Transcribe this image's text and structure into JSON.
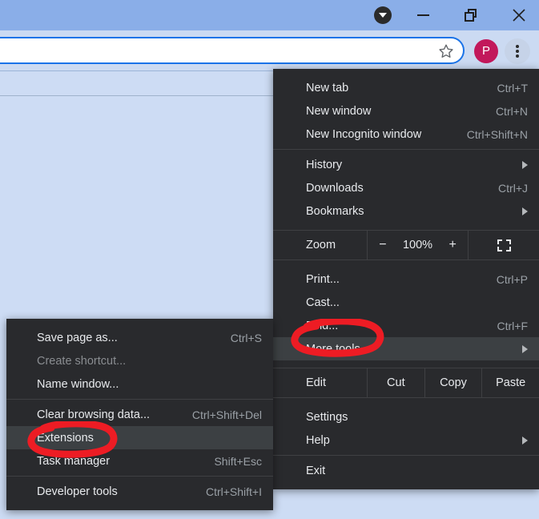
{
  "window": {
    "controls": [
      {
        "name": "update-available",
        "icon": "chevron-down-circle-icon"
      },
      {
        "name": "minimize",
        "icon": "minimize-icon"
      },
      {
        "name": "restore",
        "icon": "restore-window-icon"
      },
      {
        "name": "close",
        "icon": "close-icon",
        "glyph": "✕"
      }
    ]
  },
  "toolbar": {
    "address_value": "",
    "address_placeholder": "",
    "bookmark_icon": "star-icon",
    "profile_initial": "P",
    "menu_icon": "three-dots-vertical-icon"
  },
  "main_menu": {
    "items": [
      {
        "label": "New tab",
        "accel": "Ctrl+T",
        "submenu": false,
        "highlight": false,
        "disabled": false
      },
      {
        "label": "New window",
        "accel": "Ctrl+N",
        "submenu": false,
        "highlight": false,
        "disabled": false
      },
      {
        "label": "New Incognito window",
        "accel": "Ctrl+Shift+N",
        "submenu": false,
        "highlight": false,
        "disabled": false
      },
      {
        "label": "History",
        "accel": "",
        "submenu": true,
        "highlight": false,
        "disabled": false
      },
      {
        "label": "Downloads",
        "accel": "Ctrl+J",
        "submenu": false,
        "highlight": false,
        "disabled": false
      },
      {
        "label": "Bookmarks",
        "accel": "",
        "submenu": true,
        "highlight": false,
        "disabled": false
      },
      {
        "label": "Print...",
        "accel": "Ctrl+P",
        "submenu": false,
        "highlight": false,
        "disabled": false
      },
      {
        "label": "Cast...",
        "accel": "",
        "submenu": false,
        "highlight": false,
        "disabled": false
      },
      {
        "label": "Find...",
        "accel": "Ctrl+F",
        "submenu": false,
        "highlight": false,
        "disabled": false
      },
      {
        "label": "More tools",
        "accel": "",
        "submenu": true,
        "highlight": true,
        "disabled": false
      },
      {
        "label": "Settings",
        "accel": "",
        "submenu": false,
        "highlight": false,
        "disabled": false
      },
      {
        "label": "Help",
        "accel": "",
        "submenu": true,
        "highlight": false,
        "disabled": false
      },
      {
        "label": "Exit",
        "accel": "",
        "submenu": false,
        "highlight": false,
        "disabled": false
      }
    ],
    "zoom_row": {
      "label": "Zoom",
      "minus": "−",
      "value": "100%",
      "plus": "+",
      "fullscreen_icon": "fullscreen-icon"
    },
    "edit_row": {
      "label": "Edit",
      "cut": "Cut",
      "copy": "Copy",
      "paste": "Paste"
    }
  },
  "sub_menu": {
    "items": [
      {
        "label": "Save page as...",
        "accel": "Ctrl+S",
        "highlight": false,
        "disabled": false
      },
      {
        "label": "Create shortcut...",
        "accel": "",
        "highlight": false,
        "disabled": true
      },
      {
        "label": "Name window...",
        "accel": "",
        "highlight": false,
        "disabled": false
      },
      {
        "label": "Clear browsing data...",
        "accel": "Ctrl+Shift+Del",
        "highlight": false,
        "disabled": false
      },
      {
        "label": "Extensions",
        "accel": "",
        "highlight": true,
        "disabled": false
      },
      {
        "label": "Task manager",
        "accel": "Shift+Esc",
        "highlight": false,
        "disabled": false
      },
      {
        "label": "Developer tools",
        "accel": "Ctrl+Shift+I",
        "highlight": false,
        "disabled": false
      }
    ]
  },
  "annotations": {
    "color": "#ED1C24",
    "circles": [
      {
        "name": "more-tools-highlight-circle",
        "target": "More tools"
      },
      {
        "name": "extensions-highlight-circle",
        "target": "Extensions"
      }
    ]
  },
  "colors": {
    "titlebar": "#8aaee8",
    "toolbar": "#cbdaf2",
    "page": "#cddcf4",
    "menu_bg": "#292a2d",
    "menu_highlight": "#3c4043",
    "menu_text": "#e8eaed",
    "accel_text": "#9aa0a6",
    "omnibox_border": "#1a73e8",
    "profile": "#c2185b",
    "annotation_red": "#ED1C24"
  }
}
